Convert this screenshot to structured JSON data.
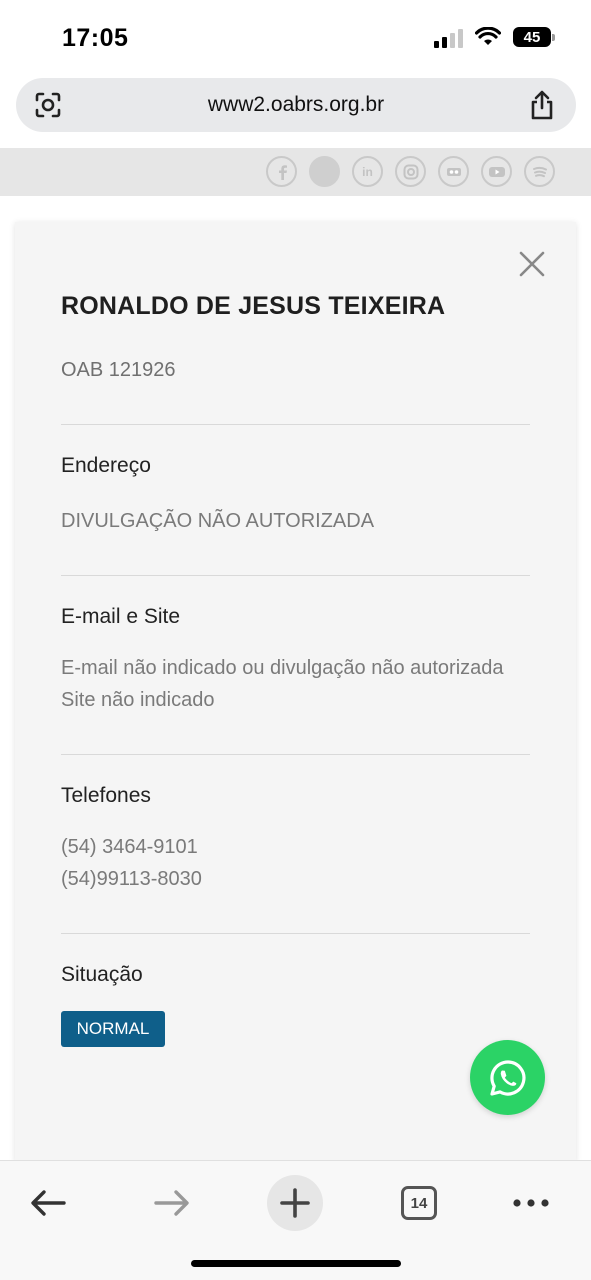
{
  "status": {
    "time": "17:05",
    "battery": "45"
  },
  "browser": {
    "url": "www2.oabrs.org.br",
    "tabs_count": "14"
  },
  "social": {
    "icons": [
      "facebook-icon",
      "circle-icon",
      "linkedin-icon",
      "instagram-icon",
      "flickr-icon",
      "youtube-icon",
      "spotify-icon"
    ],
    "linkedin_text": "in"
  },
  "profile": {
    "name": "RONALDO DE JESUS TEIXEIRA",
    "oab": "OAB 121926",
    "address_label": "Endereço",
    "address_value": "DIVULGAÇÃO NÃO AUTORIZADA",
    "email_label": "E-mail e Site",
    "email_value": "E-mail não indicado ou divulgação não autorizada",
    "site_value": "Site não indicado",
    "phones_label": "Telefones",
    "phone_1": "(54) 3464-9101",
    "phone_2": "(54)99113-8030",
    "status_label": "Situação",
    "status_value": "NORMAL"
  },
  "colors": {
    "badge": "#0f5f8a",
    "whatsapp": "#2bd366"
  }
}
